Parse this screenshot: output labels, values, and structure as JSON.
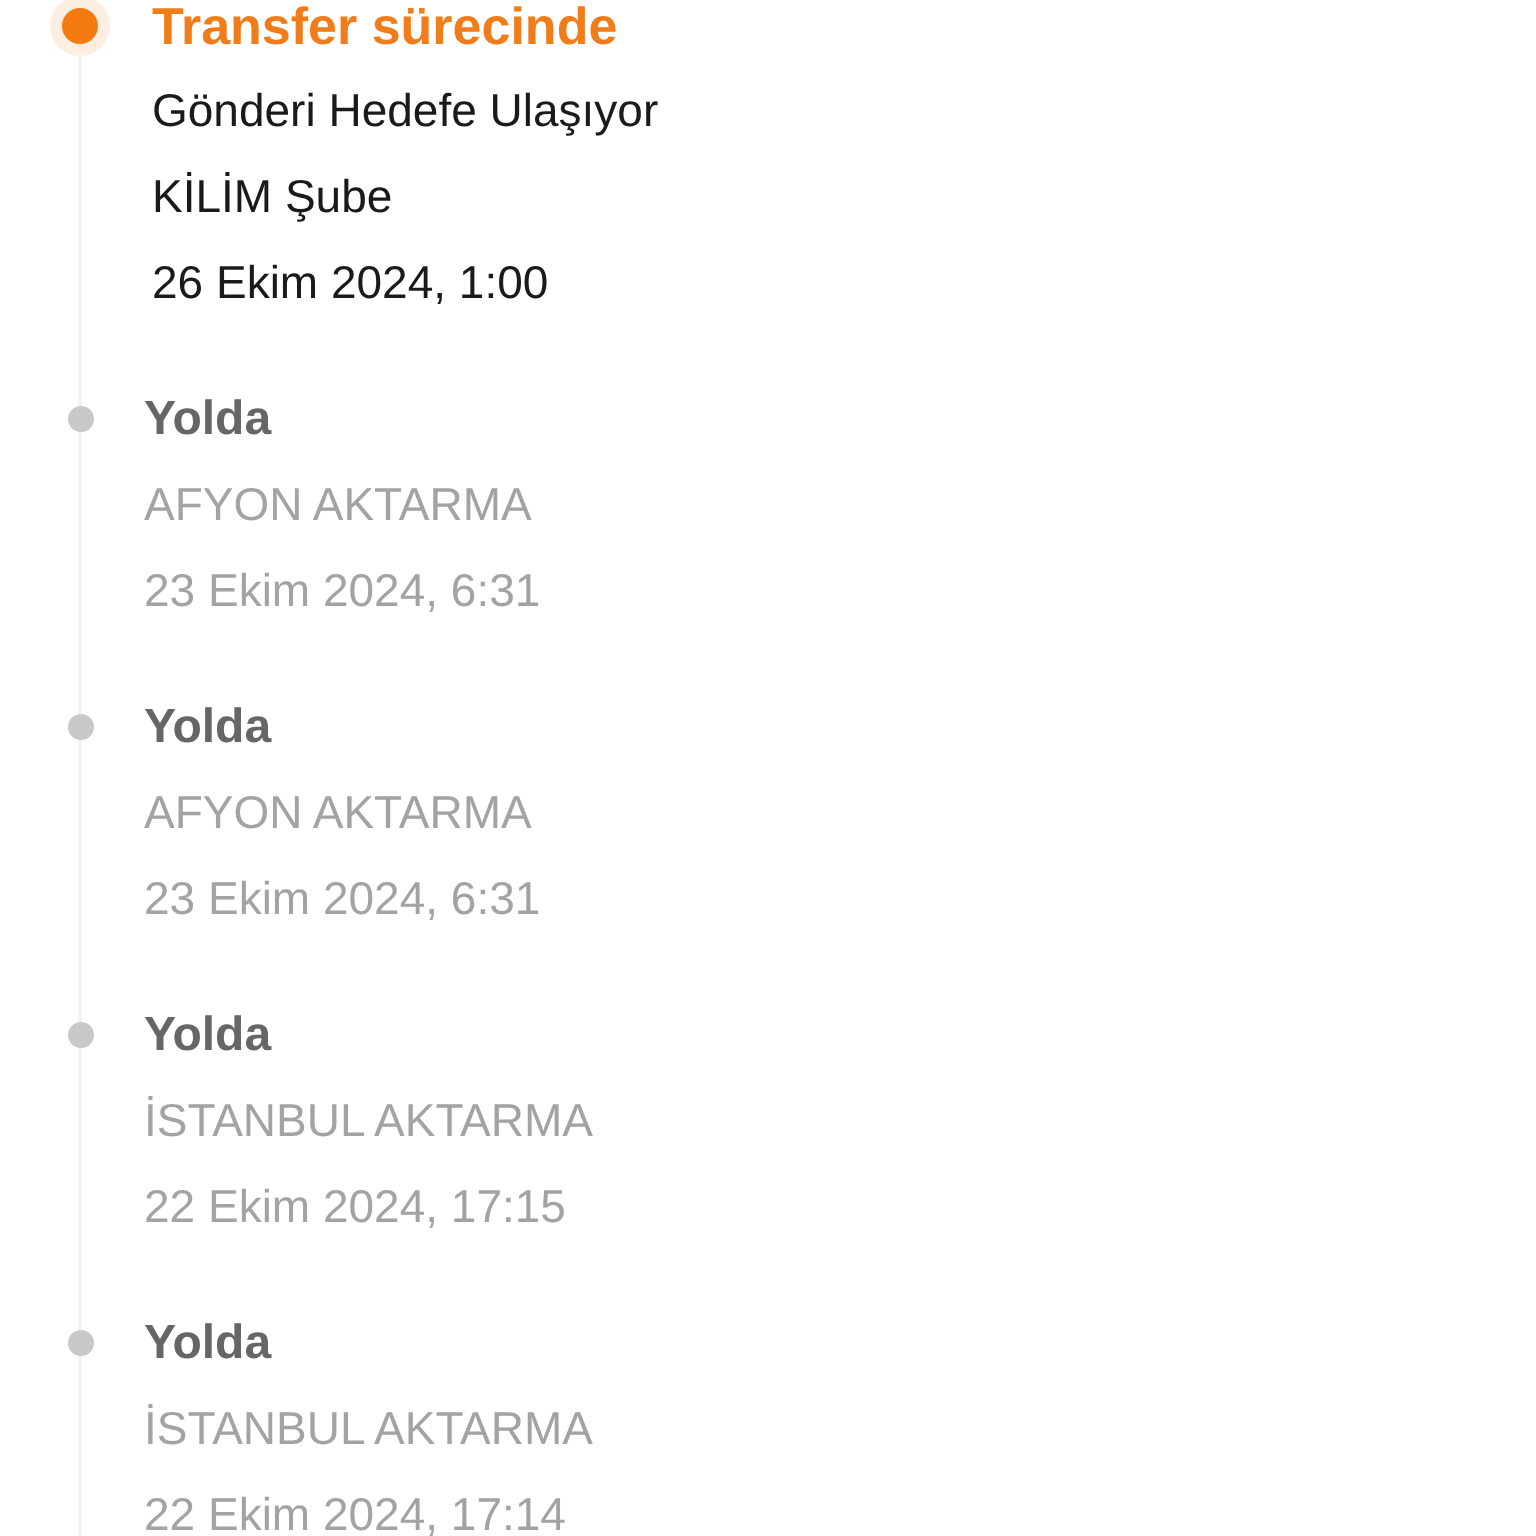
{
  "events": [
    {
      "title": "Transfer sürecinde",
      "current": true,
      "lines": [
        "Gönderi Hedefe Ulaşıyor",
        "KİLİM Şube",
        "26 Ekim 2024, 1:00"
      ]
    },
    {
      "title": "Yolda",
      "current": false,
      "lines": [
        "AFYON AKTARMA",
        "23 Ekim 2024, 6:31"
      ]
    },
    {
      "title": "Yolda",
      "current": false,
      "lines": [
        "AFYON AKTARMA",
        "23 Ekim 2024, 6:31"
      ]
    },
    {
      "title": "Yolda",
      "current": false,
      "lines": [
        "İSTANBUL AKTARMA",
        "22 Ekim 2024, 17:15"
      ]
    },
    {
      "title": "Yolda",
      "current": false,
      "lines": [
        "İSTANBUL AKTARMA",
        "22 Ekim 2024, 17:14"
      ]
    }
  ]
}
